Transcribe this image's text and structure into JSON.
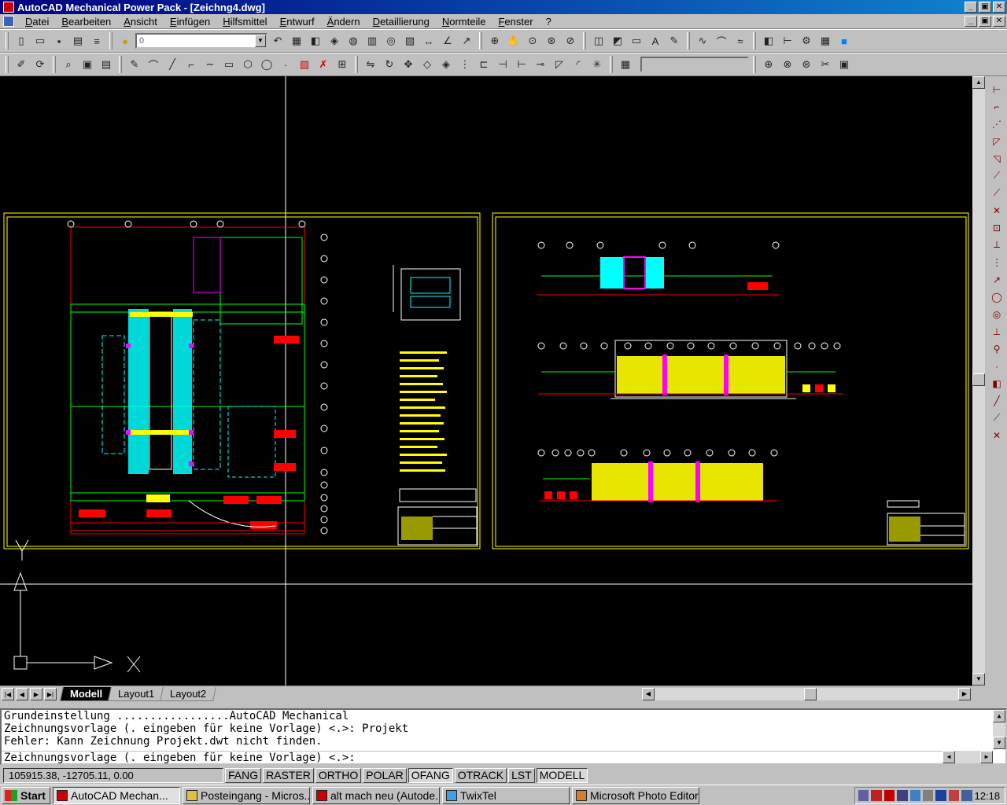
{
  "window": {
    "title": "AutoCAD Mechanical Power Pack - [Zeichng4.dwg]",
    "buttons": [
      "_",
      "▣",
      "✕"
    ]
  },
  "menu": {
    "items": [
      "Datei",
      "Bearbeiten",
      "Ansicht",
      "Einfügen",
      "Hilfsmittel",
      "Entwurf",
      "Ändern",
      "Detaillierung",
      "Normteile",
      "Fenster",
      "?"
    ]
  },
  "toolbar": {
    "layer_value": "0"
  },
  "layout_tabs": [
    "Modell",
    "Layout1",
    "Layout2"
  ],
  "command": {
    "history": [
      "Grundeinstellung .................AutoCAD Mechanical",
      "Zeichnungsvorlage (. eingeben für keine Vorlage) <.>: Projekt",
      "Fehler: Kann Zeichnung Projekt.dwt nicht finden."
    ],
    "prompt": "Zeichnungsvorlage (. eingeben für keine Vorlage) <.>:"
  },
  "status": {
    "coords": "105915.38, -12705.11, 0.00",
    "toggles": [
      {
        "label": "FANG",
        "on": false
      },
      {
        "label": "RASTER",
        "on": false
      },
      {
        "label": "ORTHO",
        "on": false
      },
      {
        "label": "POLAR",
        "on": false
      },
      {
        "label": "OFANG",
        "on": true
      },
      {
        "label": "OTRACK",
        "on": false
      },
      {
        "label": "LST",
        "on": false
      },
      {
        "label": "MODELL",
        "on": true
      }
    ]
  },
  "ucs": {
    "x_label": "X",
    "y_label": "Y"
  },
  "taskbar": {
    "start": "Start",
    "tasks": [
      {
        "label": "AutoCAD Mechan...",
        "active": true
      },
      {
        "label": "Posteingang - Micros...",
        "active": false
      },
      {
        "label": "alt mach neu (Autode...",
        "active": false
      },
      {
        "label": "TwixTel",
        "active": false
      },
      {
        "label": "Microsoft Photo Editor",
        "active": false
      }
    ],
    "clock": "12:18"
  },
  "colors": {
    "titlebar": "#000080",
    "canvas": "#000000",
    "cad_yellow": "#ffff00",
    "cad_cyan": "#00ffff",
    "cad_red": "#ff0000",
    "cad_green": "#00ff00",
    "cad_magenta": "#ff00ff"
  }
}
